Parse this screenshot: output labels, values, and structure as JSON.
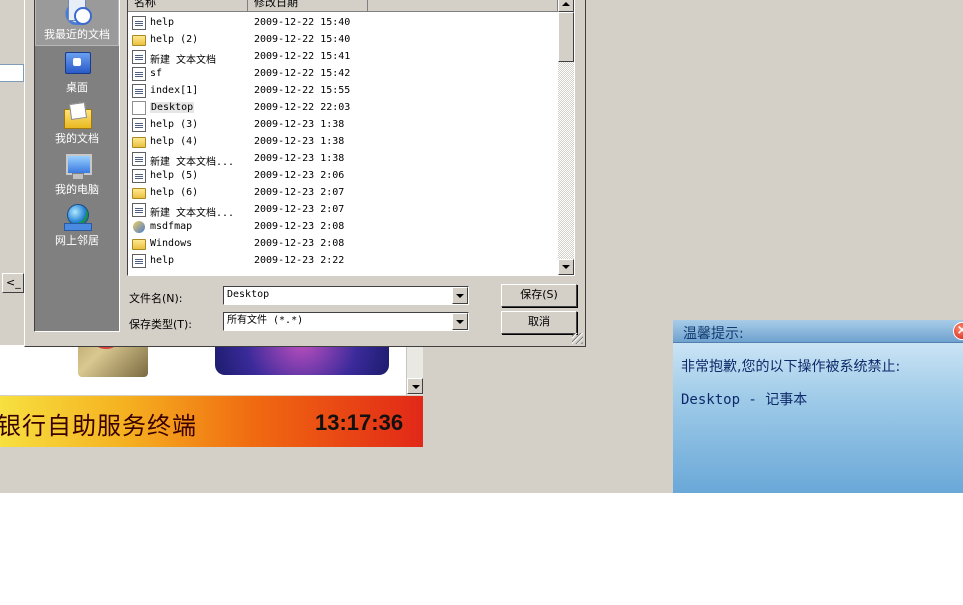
{
  "kiosk": {
    "title": "银行自助服务终端",
    "clock": "13:17:36",
    "side_button": "<_"
  },
  "save_dialog": {
    "columns": {
      "name": "名称",
      "modified": "修改日期"
    },
    "places": [
      {
        "label": "我最近的文档",
        "icon": "recent-documents-icon"
      },
      {
        "label": "桌面",
        "icon": "desktop-icon"
      },
      {
        "label": "我的文档",
        "icon": "my-documents-icon"
      },
      {
        "label": "我的电脑",
        "icon": "my-computer-icon"
      },
      {
        "label": "网上邻居",
        "icon": "network-places-icon"
      }
    ],
    "files": [
      {
        "name": "help",
        "date": "2009-12-22 15:40",
        "type": "page"
      },
      {
        "name": "help (2)",
        "date": "2009-12-22 15:40",
        "type": "folder"
      },
      {
        "name": "新建 文本文档",
        "date": "2009-12-22 15:41",
        "type": "page"
      },
      {
        "name": "sf",
        "date": "2009-12-22 15:42",
        "type": "page"
      },
      {
        "name": "index[1]",
        "date": "2009-12-22 15:55",
        "type": "page"
      },
      {
        "name": "Desktop",
        "date": "2009-12-22 22:03",
        "type": "blank"
      },
      {
        "name": "help (3)",
        "date": "2009-12-23 1:38",
        "type": "page"
      },
      {
        "name": "help (4)",
        "date": "2009-12-23 1:38",
        "type": "folder"
      },
      {
        "name": "新建 文本文档...",
        "date": "2009-12-23 1:38",
        "type": "page"
      },
      {
        "name": "help (5)",
        "date": "2009-12-23 2:06",
        "type": "page"
      },
      {
        "name": "help (6)",
        "date": "2009-12-23 2:07",
        "type": "folder"
      },
      {
        "name": "新建 文本文档...",
        "date": "2009-12-23 2:07",
        "type": "page"
      },
      {
        "name": "msdfmap",
        "date": "2009-12-23 2:08",
        "type": "app"
      },
      {
        "name": "Windows",
        "date": "2009-12-23 2:08",
        "type": "folder"
      },
      {
        "name": "help",
        "date": "2009-12-23 2:22",
        "type": "page"
      }
    ],
    "filename_label": "文件名(N):",
    "filename_value": "Desktop",
    "filetype_label": "保存类型(T):",
    "filetype_value": "所有文件 (*.*)",
    "save_button": "保存(S)",
    "cancel_button": "取消"
  },
  "notification": {
    "title": "温馨提示:",
    "message": "非常抱歉,您的以下操作被系统禁止:",
    "app": "Desktop - 记事本",
    "close_symbol": "×"
  }
}
